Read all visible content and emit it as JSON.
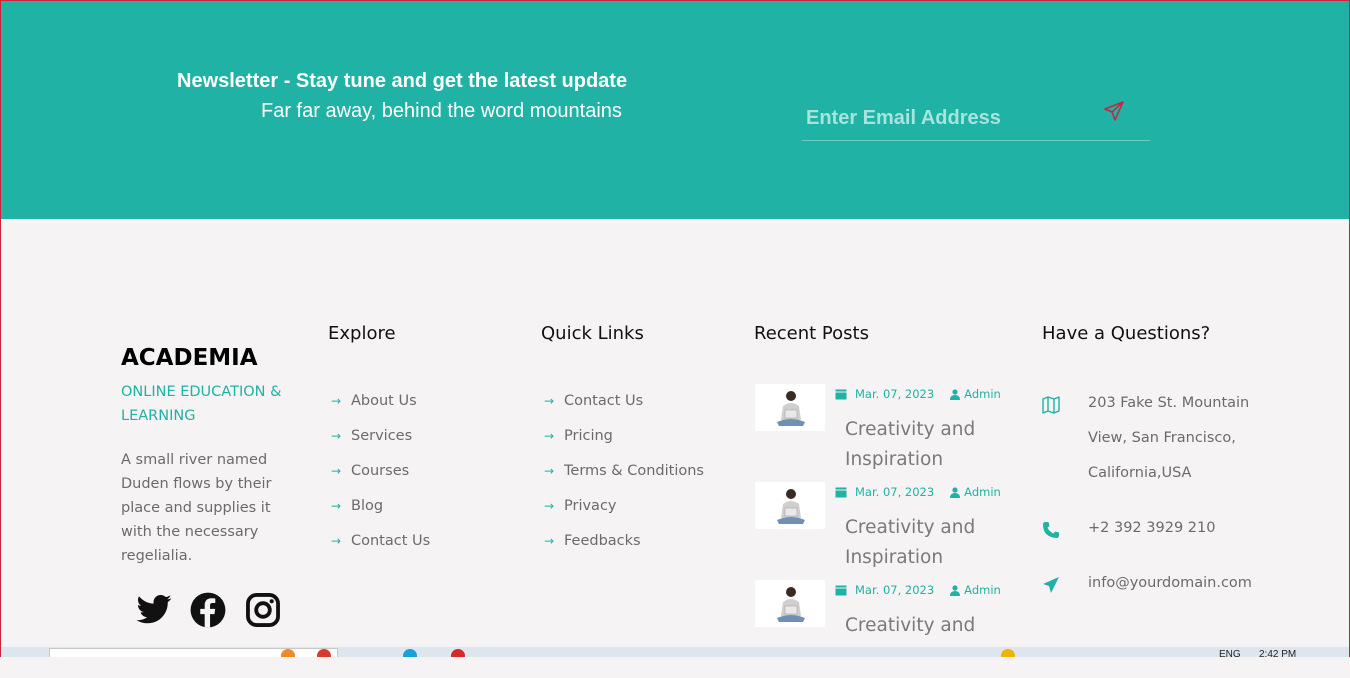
{
  "newsletter": {
    "title": "Newsletter - Stay tune and get the latest update",
    "subtitle": "Far far away, behind the word mountains",
    "email_placeholder": "Enter Email Address",
    "send_icon": "paper-plane-icon"
  },
  "brand": {
    "name": "ACADEMIA",
    "tagline": "ONLINE EDUCATION & LEARNING",
    "description": "A small river named Duden flows by their place and supplies it with the necessary regelialia.",
    "social_icons": [
      "twitter-icon",
      "facebook-icon",
      "instagram-icon"
    ]
  },
  "explore": {
    "heading": "Explore",
    "links": [
      "About Us",
      "Services",
      "Courses",
      "Blog",
      "Contact Us"
    ]
  },
  "quick_links": {
    "heading": "Quick Links",
    "links": [
      "Contact Us",
      "Pricing",
      "Terms & Conditions",
      "Privacy",
      "Feedbacks"
    ]
  },
  "recent_posts": {
    "heading": "Recent Posts",
    "posts": [
      {
        "date": "Mar. 07, 2023",
        "author": "Admin",
        "title": "Creativity and Inspiration"
      },
      {
        "date": "Mar. 07, 2023",
        "author": "Admin",
        "title": "Creativity and Inspiration"
      },
      {
        "date": "Mar. 07, 2023",
        "author": "Admin",
        "title": "Creativity and"
      }
    ]
  },
  "contact": {
    "heading": "Have a Questions?",
    "address": "203 Fake St. Mountain View, San Francisco, California,USA",
    "phone": "+2 392 3929 210",
    "email": "info@yourdomain.com"
  },
  "taskbar": {
    "lang": "ENG",
    "time": "2:42 PM"
  },
  "colors": {
    "accent": "#1fb2a5",
    "footer_bg": "#f5f3f3",
    "text_muted": "#6b6b6b"
  }
}
